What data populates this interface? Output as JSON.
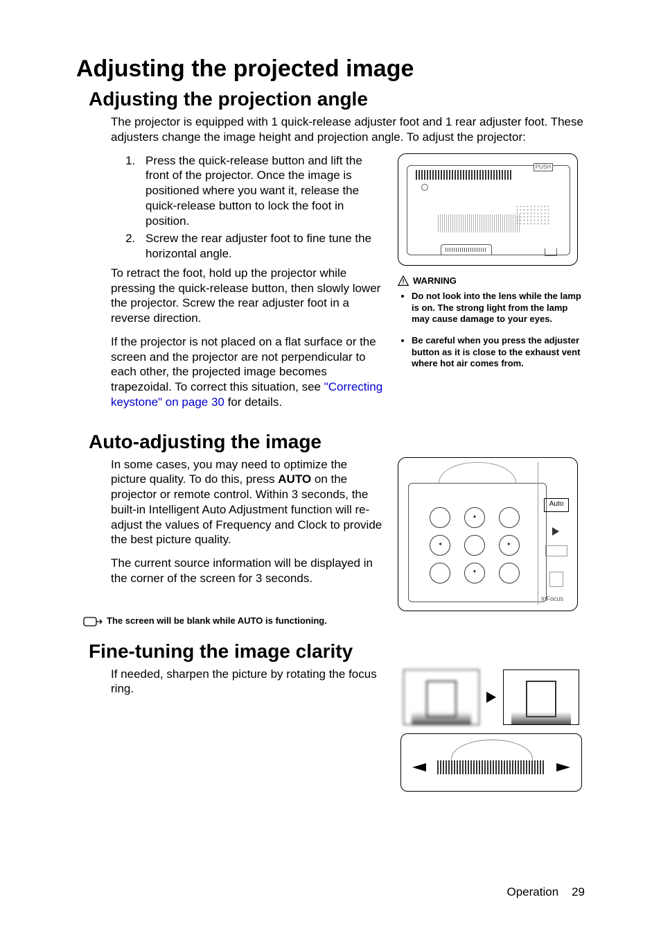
{
  "h1": "Adjusting the projected image",
  "sec1": {
    "h2": "Adjusting the projection angle",
    "intro": "The projector is equipped with 1 quick-release adjuster foot and 1 rear adjuster foot. These adjusters change the image height and projection angle. To adjust the projector:",
    "step1": "Press the quick-release button and lift the front of the projector. Once the image is positioned where you want it, release the quick-release button to lock the foot in position.",
    "step2": "Screw the rear adjuster foot to fine tune the horizontal angle.",
    "retract": "To retract the foot, hold up the projector while pressing the quick-release button, then slowly lower the projector. Screw the rear adjuster foot in a reverse direction.",
    "trapezoid_a": "If the projector is not placed on a flat surface or the screen and the projector are not perpendicular to each other, the projected image becomes trapezoidal. To correct this situation, see ",
    "trapezoid_link": "\"Correcting keystone\" on page 30",
    "trapezoid_b": " for details.",
    "push_label": "PUSH",
    "warning_label": "WARNING",
    "warn1": "Do not look into the lens while the lamp is on. The strong light from the lamp may cause damage to your eyes.",
    "warn2": "Be careful when you press the adjuster button as it is close to the exhaust vent where hot air comes from."
  },
  "sec2": {
    "h2": "Auto-adjusting the image",
    "p1a": "In some cases, you may need to optimize the picture quality. To do this, press ",
    "p1_bold": "AUTO",
    "p1b": " on the projector or remote control. Within 3 seconds, the built-in Intelligent Auto Adjustment function will re-adjust the values of Frequency and Clock to provide the best picture quality.",
    "p2": "The current source information will be displayed in the corner of the screen for 3 seconds.",
    "note": "The screen will be blank while AUTO is functioning.",
    "auto_btn": "Auto"
  },
  "sec3": {
    "h2": "Fine-tuning the image clarity",
    "p1": "If needed, sharpen the picture by rotating the focus ring."
  },
  "footer": {
    "section": "Operation",
    "page": "29"
  }
}
